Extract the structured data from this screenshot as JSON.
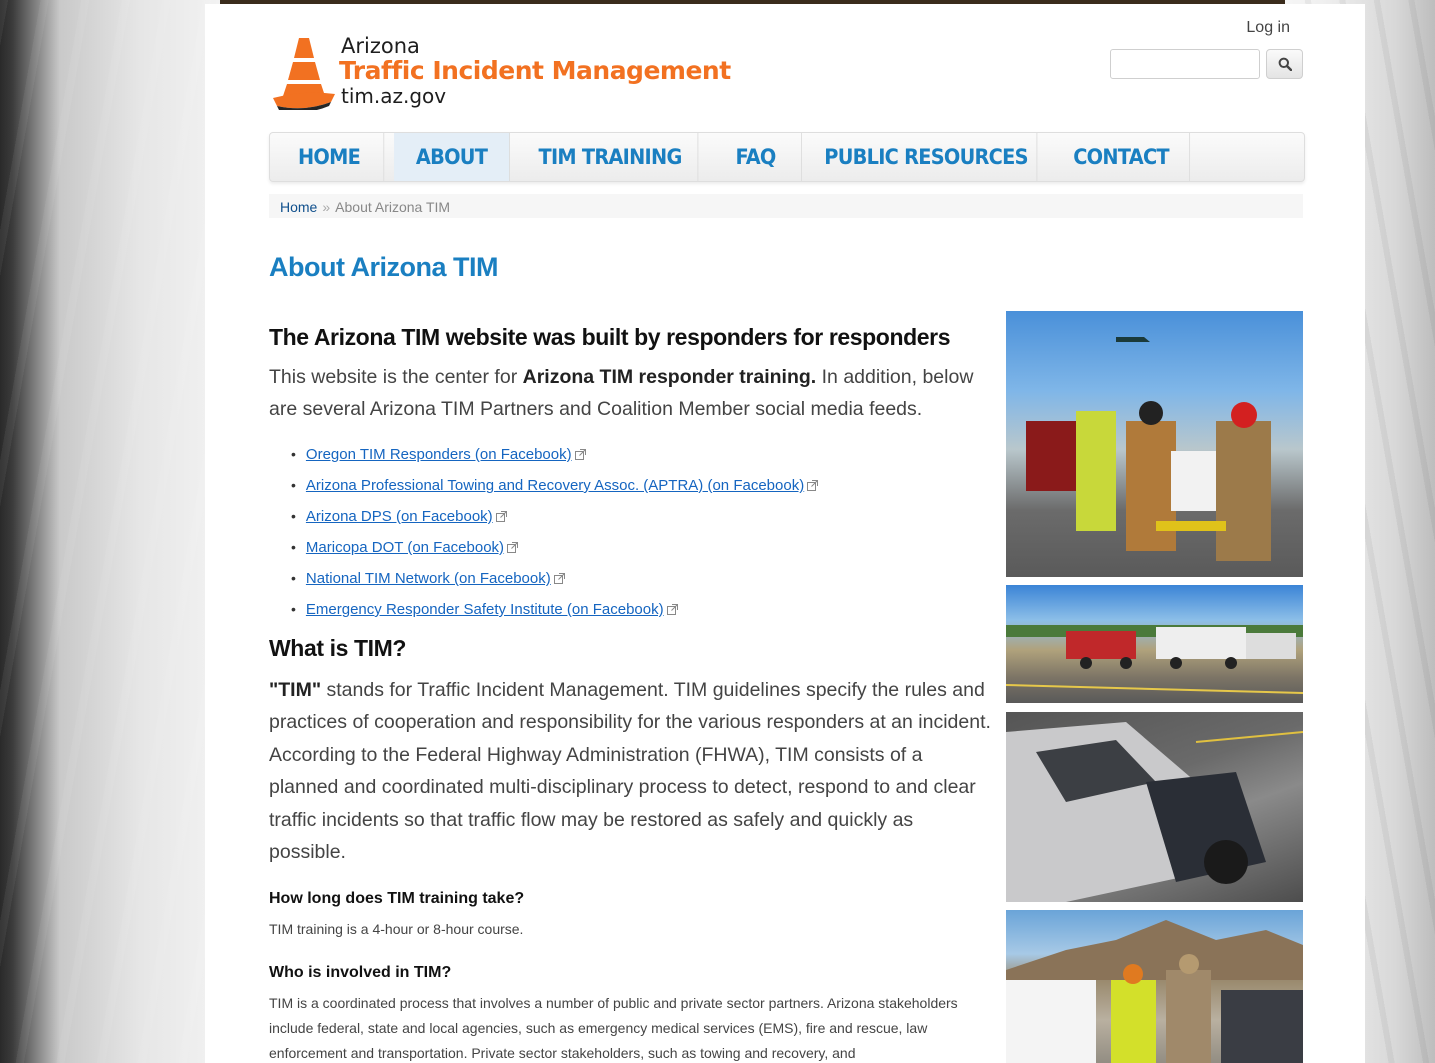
{
  "site": {
    "logo_line1": "Arizona",
    "logo_line2": "Traffic Incident Management",
    "logo_line3": "tim.az.gov",
    "brand_orange": "#f27121",
    "link_blue": "#1a7fc1"
  },
  "header": {
    "login_label": "Log in",
    "search_placeholder": "",
    "search_icon": "search-icon"
  },
  "nav": {
    "items": [
      {
        "label": "HOME"
      },
      {
        "label": "ABOUT"
      },
      {
        "label": "TIM TRAINING"
      },
      {
        "label": "FAQ"
      },
      {
        "label": "PUBLIC RESOURCES"
      },
      {
        "label": "CONTACT"
      }
    ],
    "active": "ABOUT"
  },
  "breadcrumb": {
    "home": "Home",
    "separator": "»",
    "current": "About Arizona TIM"
  },
  "page": {
    "title": "About Arizona TIM",
    "section1_heading": "The Arizona TIM website was built by responders for responders",
    "section1_pre": "This website is the center for ",
    "section1_bold": "Arizona TIM responder training.",
    "section1_post": " In addition, below are several Arizona TIM Partners and Coalition Member social media feeds.",
    "links": [
      "Oregon TIM Responders (on Facebook)",
      "Arizona Professional Towing and Recovery Assoc. (APTRA) (on Facebook)",
      "Arizona DPS (on Facebook)",
      "Maricopa DOT (on Facebook)",
      "National TIM Network (on Facebook)",
      "Emergency Responder Safety Institute (on Facebook)"
    ],
    "section2_heading": "What is TIM?",
    "section2_bold": "\"TIM\"",
    "section2_text": " stands for Traffic Incident Management. TIM guidelines specify the rules and practices of cooperation and responsibility for the various responders at an incident. According to the Federal Highway Administration (FHWA), TIM consists of a planned and coordinated multi-disciplinary process to detect, respond to and clear traffic incidents so that traffic flow may be restored as safely and quickly as possible.",
    "q1": "How long does TIM training take?",
    "a1": "TIM training is a 4-hour or 8-hour course.",
    "q2": "Who is involved in TIM?",
    "a2": "TIM is a coordinated process that involves a number of public and private sector partners. Arizona stakeholders include federal, state and local agencies, such as emergency medical services (EMS), fire and rescue, law enforcement and transportation. Private sector stakeholders, such as towing and recovery, and"
  }
}
